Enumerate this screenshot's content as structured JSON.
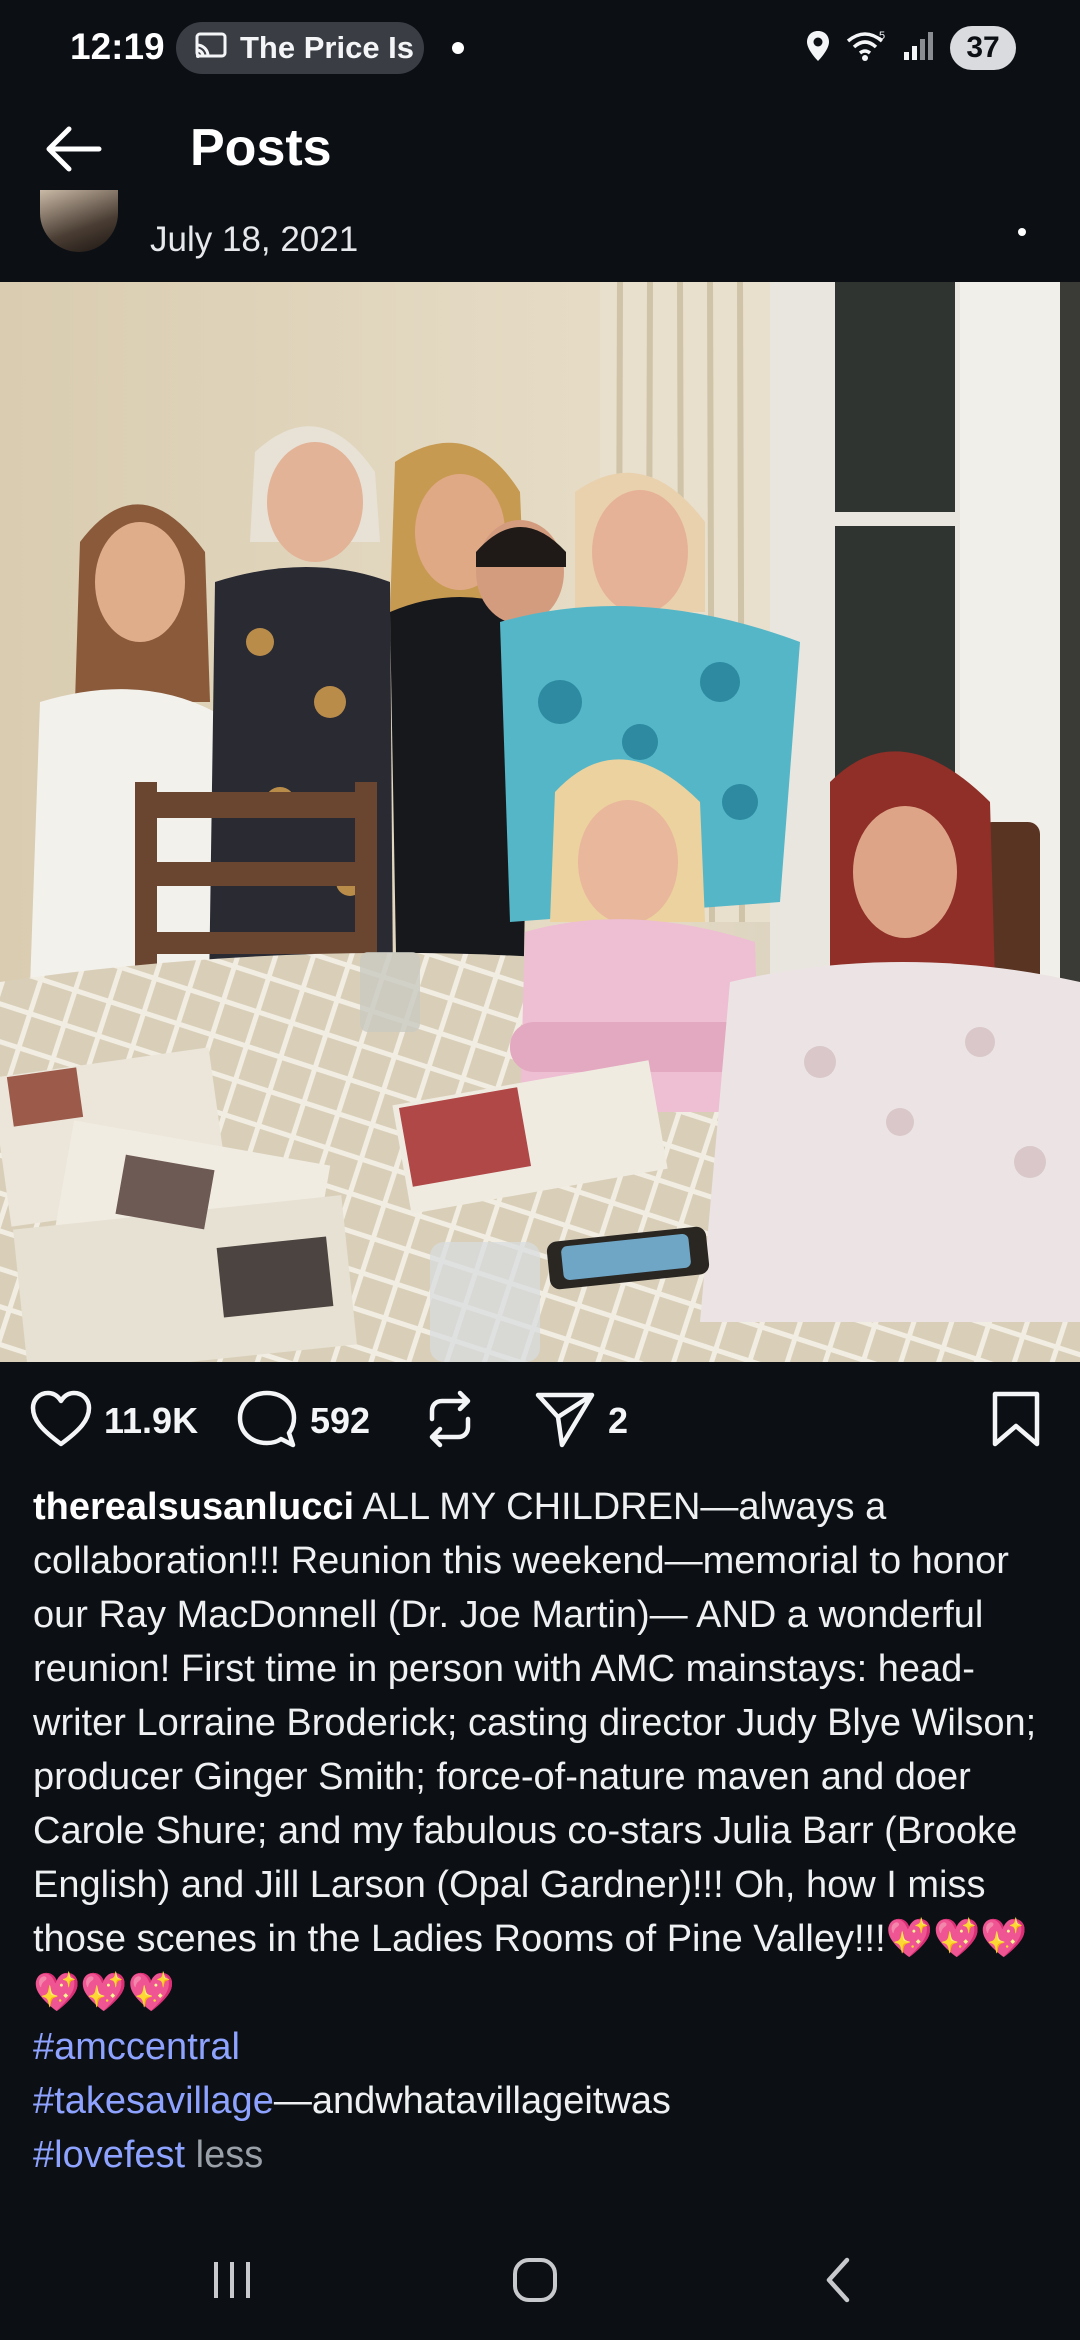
{
  "status_bar": {
    "time": "12:19",
    "cast_label": "The Price Is",
    "battery": "37",
    "icons": [
      "cast-icon",
      "location-icon",
      "wifi-icon",
      "signal-icon"
    ]
  },
  "app_bar": {
    "title": "Posts",
    "back_icon": "arrow-left-icon"
  },
  "post": {
    "date": "July 18, 2021",
    "likes": "11.9K",
    "comments": "592",
    "shares": "2",
    "caption": {
      "username": "therealsusanlucci",
      "text": "ALL MY CHILDREN—always a collaboration!!! Reunion this weekend—memorial to honor our Ray MacDonnell (Dr. Joe Martin)— AND a wonderful reunion!  First time in person with AMC mainstays: head-writer Lorraine Broderick; casting director Judy Blye Wilson; producer Ginger Smith; force-of-nature maven and doer Carole Shure; and my fabulous co-stars Julia Barr (Brooke English) and Jill Larson (Opal Gardner)!!! Oh, how I miss those scenes in the Ladies Rooms of Pine Valley!!!",
      "emoji": "💖💖💖💖💖💖",
      "tag1": "#amccentral",
      "tag2": "#takesavillage",
      "tag2_suffix": "—andwhatavillageitwas",
      "tag3": "#lovefest",
      "less_label": "less"
    }
  },
  "colors": {
    "background": "#0c0f14",
    "hashtag": "#8ea3ff",
    "muted": "#9aa0a8"
  }
}
